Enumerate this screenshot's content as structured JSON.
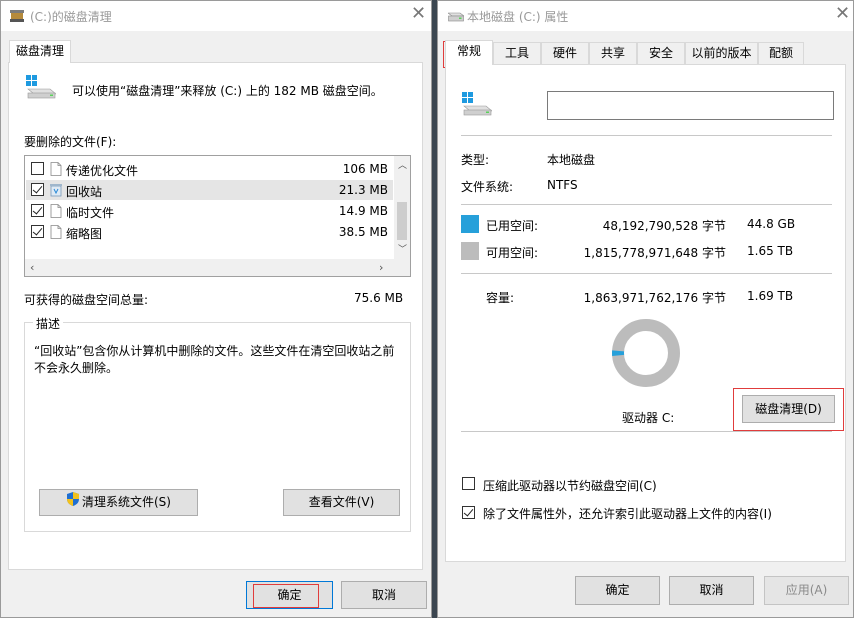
{
  "cleanup": {
    "title": "(C:)的磁盘清理",
    "tab": "磁盘清理",
    "intro": "可以使用“磁盘清理”来释放  (C:) 上的 182 MB 磁盘空间。",
    "files_label": "要删除的文件(F):",
    "files": [
      {
        "name": "传递优化文件",
        "size": "106 MB",
        "checked": false
      },
      {
        "name": "回收站",
        "size": "21.3 MB",
        "checked": true
      },
      {
        "name": "临时文件",
        "size": "14.9 MB",
        "checked": true
      },
      {
        "name": "缩略图",
        "size": "38.5 MB",
        "checked": true
      }
    ],
    "total_label": "可获得的磁盘空间总量:",
    "total_value": "75.6 MB",
    "desc_legend": "描述",
    "desc_text_1": "“回收站”包含你从计算机中删除的文件。这些文件在清空回收站之前",
    "desc_text_2": "不会永久删除。",
    "clean_system_btn": "清理系统文件(S)",
    "view_files_btn": "查看文件(V)",
    "ok_btn": "确定",
    "cancel_btn": "取消"
  },
  "props": {
    "title": "本地磁盘 (C:) 属性",
    "tabs": [
      "常规",
      "工具",
      "硬件",
      "共享",
      "安全",
      "以前的版本",
      "配额"
    ],
    "name_value": "",
    "type_label": "类型:",
    "type_value": "本地磁盘",
    "fs_label": "文件系统:",
    "fs_value": "NTFS",
    "used_label": "已用空间:",
    "used_bytes": "48,192,790,528 字节",
    "used_size": "44.8 GB",
    "free_label": "可用空间:",
    "free_bytes": "1,815,778,971,648 字节",
    "free_size": "1.65 TB",
    "cap_label": "容量:",
    "cap_bytes": "1,863,971,762,176 字节",
    "cap_size": "1.69 TB",
    "used_fraction": 0.026,
    "drive_label": "驱动器 C:",
    "cleanup_btn": "磁盘清理(D)",
    "compress_label": "压缩此驱动器以节约磁盘空间(C)",
    "compress_checked": false,
    "index_label": "除了文件属性外，还允许索引此驱动器上文件的内容(I)",
    "index_checked": true,
    "ok_btn": "确定",
    "cancel_btn": "取消",
    "apply_btn": "应用(A)"
  },
  "colors": {
    "used": "#26a0da",
    "free": "#bcbcbc",
    "highlight": "#e03c3c"
  },
  "icons": [
    "cleanup-title-icon",
    "drive-icon",
    "recycle-bin-icon",
    "file-icon",
    "shield-icon",
    "properties-title-icon"
  ]
}
